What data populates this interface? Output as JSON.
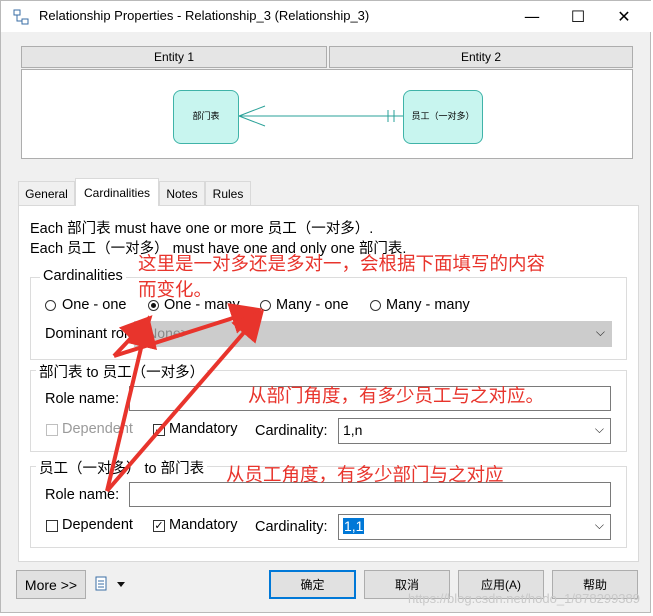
{
  "window": {
    "title": "Relationship Properties - Relationship_3 (Relationship_3)",
    "controls": {
      "minimize": "—",
      "maximize": "☐",
      "close": "✕"
    }
  },
  "entities": {
    "header1": "Entity 1",
    "header2": "Entity 2",
    "entity1_name": "部门表",
    "entity2_name": "员工（一对多）"
  },
  "tabs": [
    {
      "label": "General"
    },
    {
      "label": "Cardinalities",
      "active": true
    },
    {
      "label": "Notes"
    },
    {
      "label": "Rules"
    }
  ],
  "sentences": {
    "line1": "Each 部门表 must have one or more 员工（一对多）.",
    "line2": "Each 员工（一对多） must have one and only one 部门表."
  },
  "cardinalities": {
    "title": "Cardinalities",
    "options": [
      "One - one",
      "One - many",
      "Many - one",
      "Many - many"
    ],
    "selected": "One - many",
    "dominant_role_label": "Dominant role:",
    "dominant_role_value": "<None>"
  },
  "role1": {
    "title": "部门表 to 员工（一对多）",
    "role_name_label": "Role name:",
    "role_name_value": "",
    "dependent_label": "Dependent",
    "dependent_checked": false,
    "dependent_enabled": false,
    "mandatory_label": "Mandatory",
    "mandatory_checked": true,
    "cardinality_label": "Cardinality:",
    "cardinality_value": "1,n"
  },
  "role2": {
    "title": "员工（一对多） to 部门表",
    "role_name_label": "Role name:",
    "role_name_value": "",
    "dependent_label": "Dependent",
    "dependent_checked": false,
    "dependent_enabled": true,
    "mandatory_label": "Mandatory",
    "mandatory_checked": true,
    "cardinality_label": "Cardinality:",
    "cardinality_value": "1,1"
  },
  "annotations": {
    "a1_line1": "这里是一对多还是多对一，会根据下面填写的内容",
    "a1_line2": "而变化。",
    "a2": "从部门角度，有多少员工与之对应。",
    "a3": "从员工角度，有多少部门与之对应",
    "color": "#e8342c"
  },
  "footer": {
    "more": "More >>",
    "ok": "确定",
    "cancel": "取消",
    "apply": "应用(A)",
    "help": "帮助",
    "watermark": "https://blog.csdn.net/hodo_1/878299389"
  }
}
